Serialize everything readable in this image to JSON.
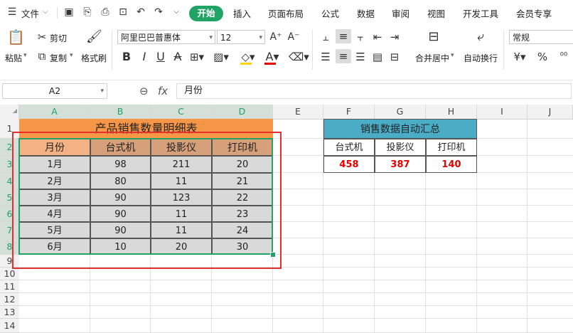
{
  "menubar": {
    "file_label": "文件",
    "tabs": [
      "开始",
      "插入",
      "页面布局",
      "公式",
      "数据",
      "审阅",
      "视图",
      "开发工具",
      "会员专享"
    ]
  },
  "ribbon": {
    "paste": "粘贴",
    "cut": "剪切",
    "copy": "复制",
    "format_painter": "格式刷",
    "font_name": "阿里巴巴普惠体",
    "font_size": "12",
    "merge_center": "合并居中",
    "wrap_text": "自动换行",
    "number_format": "常规",
    "bold": "B",
    "italic": "I",
    "underline": "U",
    "strike": "A",
    "font_color": "A",
    "currency": "¥",
    "percent": "%"
  },
  "formula_bar": {
    "name_box": "A2",
    "fx": "fx",
    "value": "月份"
  },
  "grid": {
    "columns": [
      "A",
      "B",
      "C",
      "D",
      "E",
      "F",
      "G",
      "H",
      "I",
      "J"
    ],
    "rows": [
      "1",
      "2",
      "3",
      "4",
      "5",
      "6",
      "7",
      "8",
      "9",
      "10",
      "11",
      "12",
      "13",
      "14"
    ]
  },
  "table1": {
    "title": "产品销售数量明细表",
    "headers": [
      "月份",
      "台式机",
      "投影仪",
      "打印机"
    ],
    "rows": [
      [
        "1月",
        "98",
        "211",
        "20"
      ],
      [
        "2月",
        "80",
        "11",
        "21"
      ],
      [
        "3月",
        "90",
        "123",
        "22"
      ],
      [
        "4月",
        "90",
        "11",
        "23"
      ],
      [
        "5月",
        "90",
        "11",
        "24"
      ],
      [
        "6月",
        "10",
        "20",
        "30"
      ]
    ]
  },
  "table2": {
    "title": "销售数据自动汇总",
    "headers": [
      "台式机",
      "投影仪",
      "打印机"
    ],
    "values": [
      "458",
      "387",
      "140"
    ]
  },
  "colors": {
    "accent": "#21a366",
    "title_orange": "#f79646",
    "header_tan": "#f4b183",
    "header_dark_tan": "#d6a07a",
    "data_gray": "#d9d9d9",
    "summary_blue": "#4bacc6",
    "total_red": "#e00000",
    "highlight_red": "#e03030"
  }
}
